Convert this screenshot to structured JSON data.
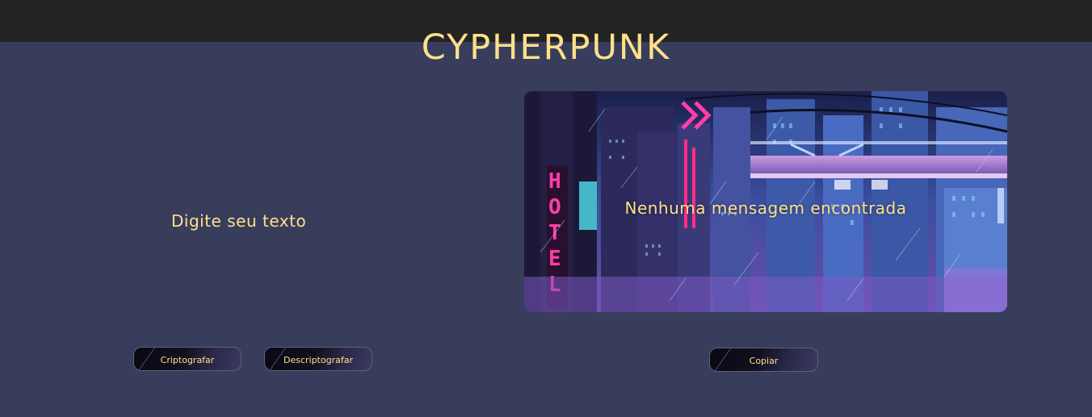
{
  "header": {
    "title": "CYPHERPUNK"
  },
  "input": {
    "prompt": "Digite seu texto"
  },
  "output": {
    "message": "Nenhuma mensagem encontrada"
  },
  "actions": {
    "encrypt_label": "Criptografar",
    "decrypt_label": "Descriptografar",
    "copy_label": "Copiar"
  },
  "colors": {
    "background": "#383d5b",
    "header_bg": "#232323",
    "accent_text": "#ffe08a"
  }
}
